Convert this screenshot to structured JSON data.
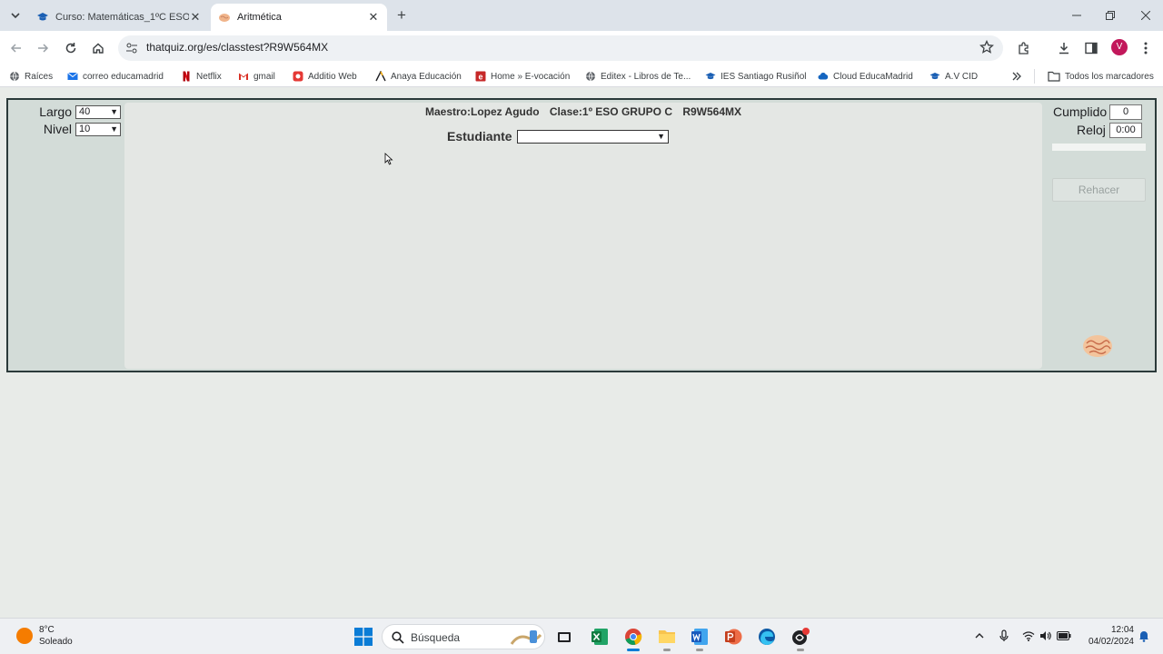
{
  "browser": {
    "tabs": [
      {
        "title": "Curso: Matemáticas_1ºC ESO_V",
        "active": false
      },
      {
        "title": "Aritmética",
        "active": true
      }
    ],
    "url": "thatquiz.org/es/classtest?R9W564MX",
    "profile_initial": "V",
    "bookmarks": [
      {
        "label": "Raíces",
        "icon": "globe-icon"
      },
      {
        "label": "correo educamadrid",
        "icon": "mail-icon"
      },
      {
        "label": "Netflix",
        "icon": "netflix-icon"
      },
      {
        "label": "gmail",
        "icon": "gmail-icon"
      },
      {
        "label": "Additio Web",
        "icon": "additio-icon"
      },
      {
        "label": "Anaya Educación",
        "icon": "anaya-icon"
      },
      {
        "label": "Home » E-vocación",
        "icon": "evocacion-icon"
      },
      {
        "label": "Editex - Libros de Te...",
        "icon": "globe-icon"
      },
      {
        "label": "IES Santiago Rusiñol",
        "icon": "graduation-cap-icon"
      },
      {
        "label": "Cloud EducaMadrid",
        "icon": "cloud-icon"
      },
      {
        "label": "A.V CID",
        "icon": "graduation-cap-icon"
      }
    ],
    "all_bookmarks": "Todos los marcadores"
  },
  "quiz": {
    "length_label": "Largo",
    "length_value": "40",
    "level_label": "Nivel",
    "level_value": "10",
    "teacher": "Maestro:Lopez Agudo",
    "class_name": "Clase:1º ESO GRUPO C",
    "class_code": "R9W564MX",
    "student_label": "Estudiante",
    "student_value": "",
    "done_label": "Cumplido",
    "done_value": "0",
    "clock_label": "Reloj",
    "clock_value": "0:00",
    "progress_percent": 0,
    "redo_label": "Rehacer"
  },
  "taskbar": {
    "temperature": "8°C",
    "weather": "Soleado",
    "search_placeholder": "Búsqueda",
    "time": "12:04",
    "date": "04/02/2024"
  },
  "colors": {
    "frame_bg": "#d3dcd8",
    "inner_bg": "#e4e7e4",
    "chrome_bg": "#dde3ea"
  }
}
